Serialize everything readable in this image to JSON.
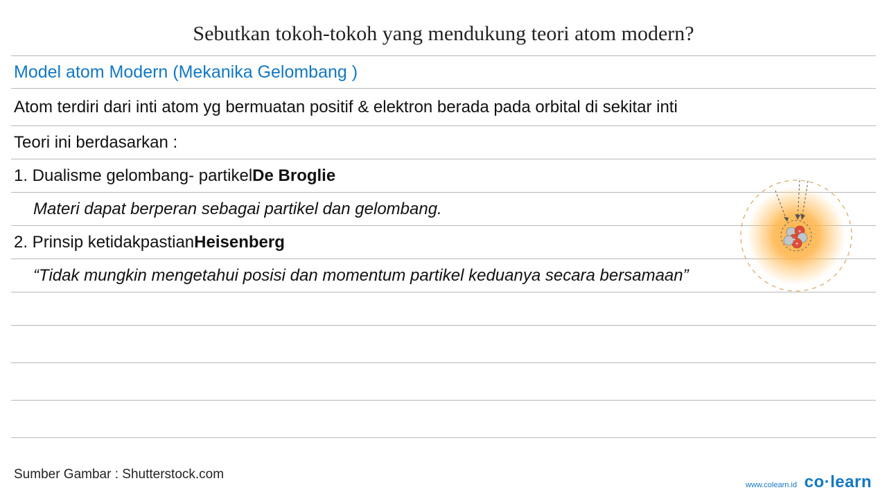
{
  "title": "Sebutkan tokoh-tokoh yang mendukung teori atom modern?",
  "subtitle": "Model atom Modern (Mekanika Gelombang )",
  "intro": "Atom terdiri dari inti atom yg bermuatan positif & elektron berada pada orbital di sekitar inti",
  "basis_label": "Teori ini berdasarkan :",
  "point1_pre": "1. Dualisme gelombang- partikel ",
  "point1_bold": "De Broglie",
  "point1_detail": "Materi dapat berperan sebagai partikel dan gelombang.",
  "point2_pre": "2. Prinsip ketidakpastian ",
  "point2_bold": "Heisenberg",
  "point2_detail": "“Tidak mungkin mengetahui posisi dan momentum partikel keduanya secara bersamaan”",
  "image_source": "Sumber Gambar : Shutterstock.com",
  "site_url": "www.colearn.id",
  "brand_co": "co",
  "brand_dot": "·",
  "brand_learn": "learn"
}
